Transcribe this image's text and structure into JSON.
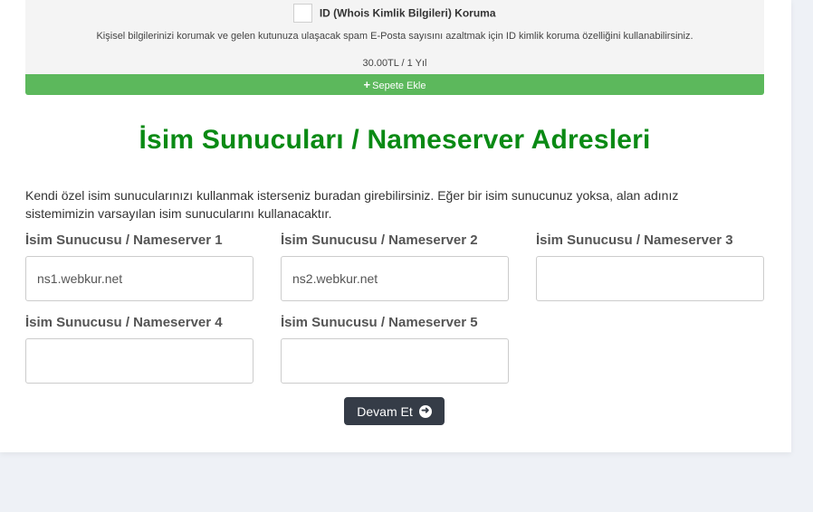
{
  "addon": {
    "title": "ID (Whois Kimlik Bilgileri) Koruma",
    "description": "Kişisel bilgilerinizi korumak ve gelen kutunuza ulaşacak spam E-Posta sayısını azaltmak için ID kimlik koruma özelliğini kullanabilirsiniz.",
    "price": "30.00TL / 1 Yıl",
    "add_button_label": "Sepete Ekle",
    "add_button_icon": "plus-icon",
    "checked": false
  },
  "nameservers": {
    "title": "İsim Sunucuları / Nameserver Adresleri",
    "intro": "Kendi özel isim sunucularınızı kullanmak isterseniz buradan girebilirsiniz. Eğer bir isim sunucunuz yoksa, alan adınız sistemimizin varsayılan isim sunucularını kullanacaktır.",
    "fields": [
      {
        "label": "İsim Sunucusu / Nameserver 1",
        "value": "ns1.webkur.net"
      },
      {
        "label": "İsim Sunucusu / Nameserver 2",
        "value": "ns2.webkur.net"
      },
      {
        "label": "İsim Sunucusu / Nameserver 3",
        "value": ""
      },
      {
        "label": "İsim Sunucusu / Nameserver 4",
        "value": ""
      },
      {
        "label": "İsim Sunucusu / Nameserver 5",
        "value": ""
      }
    ],
    "continue_label": "Devam Et",
    "continue_icon": "arrow-circle-right-icon"
  },
  "colors": {
    "accent_green": "#5cb85c",
    "title_green": "#0a8a14",
    "button_dark": "#353c47",
    "page_bg": "#eef1f6"
  }
}
